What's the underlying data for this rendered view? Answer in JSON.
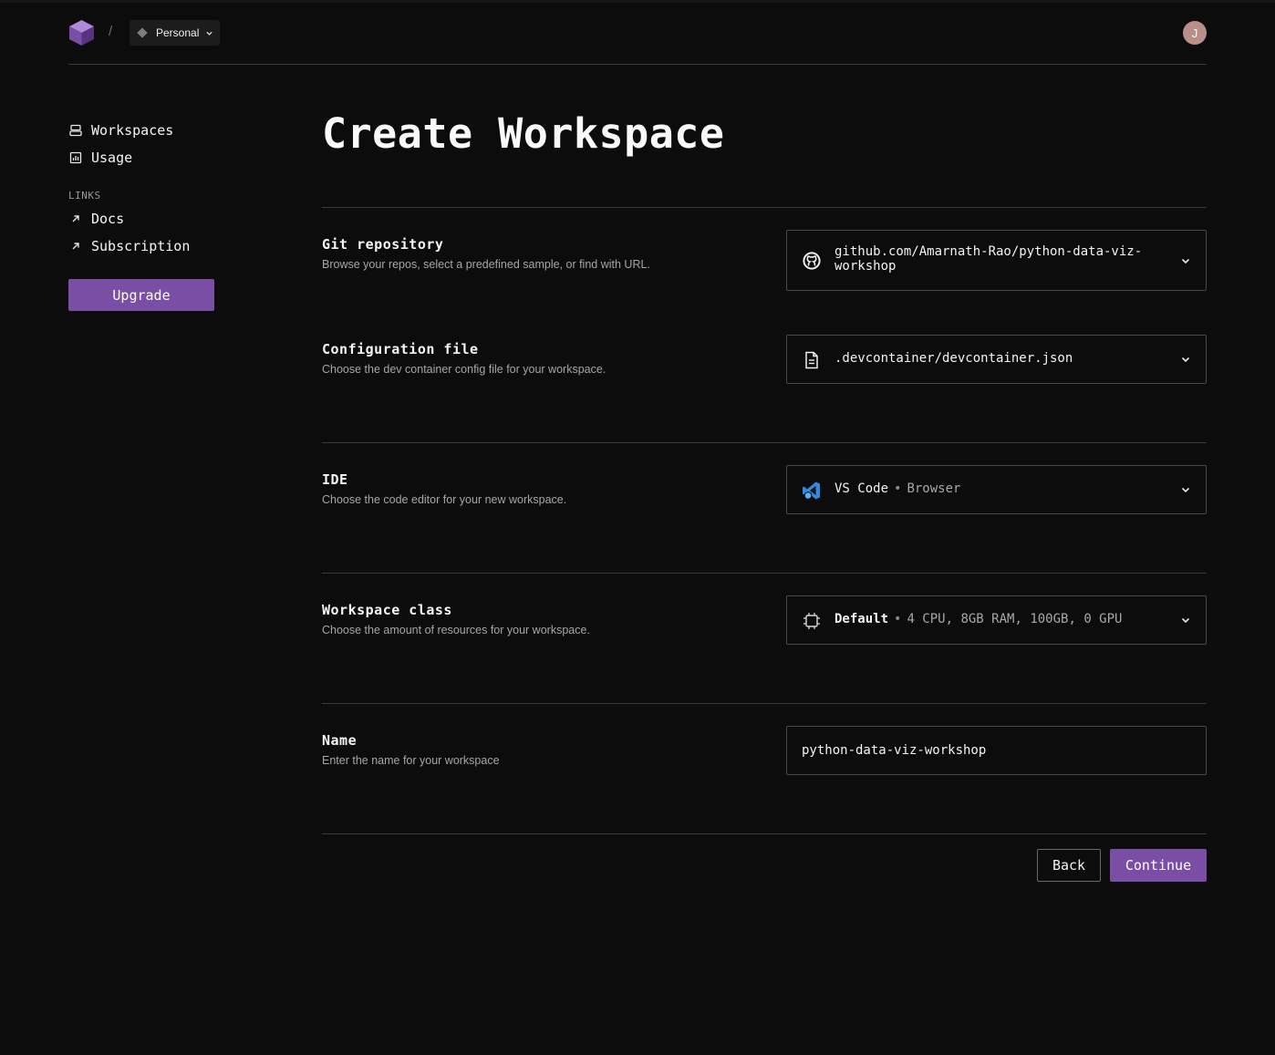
{
  "header": {
    "org_name": "Personal",
    "separator": "/",
    "avatar_initial": "J"
  },
  "sidebar": {
    "items": [
      {
        "label": "Workspaces",
        "icon": "workspaces-icon"
      },
      {
        "label": "Usage",
        "icon": "usage-chart-icon"
      }
    ],
    "links_heading": "LINKS",
    "links": [
      {
        "label": "Docs",
        "icon": "external-arrow-icon"
      },
      {
        "label": "Subscription",
        "icon": "external-arrow-icon"
      }
    ],
    "upgrade_label": "Upgrade"
  },
  "main": {
    "title": "Create Workspace",
    "sections": {
      "repo": {
        "title": "Git repository",
        "description": "Browse your repos, select a predefined sample, or find with URL.",
        "value_line1": "github.com/Amarnath-Rao/python-data-viz-",
        "value_line2": "workshop"
      },
      "config": {
        "title": "Configuration file",
        "description": "Choose the dev container config file for your workspace.",
        "value": ".devcontainer/devcontainer.json"
      },
      "ide": {
        "title": "IDE",
        "description": "Choose the code editor for your new workspace.",
        "value": "VS Code",
        "separator": "•",
        "detail": "Browser"
      },
      "class": {
        "title": "Workspace class",
        "description": "Choose the amount of resources for your workspace.",
        "value": "Default",
        "separator": "•",
        "detail": "4 CPU, 8GB RAM, 100GB, 0 GPU"
      },
      "name": {
        "title": "Name",
        "description": "Enter the name for your workspace",
        "value": "python-data-viz-workshop"
      }
    },
    "back_label": "Back",
    "continue_label": "Continue"
  },
  "colors": {
    "background": "#0c0c0c",
    "accent": "#7b4ea6",
    "border": "#4a4a4a",
    "divider": "#3a3a3a"
  }
}
